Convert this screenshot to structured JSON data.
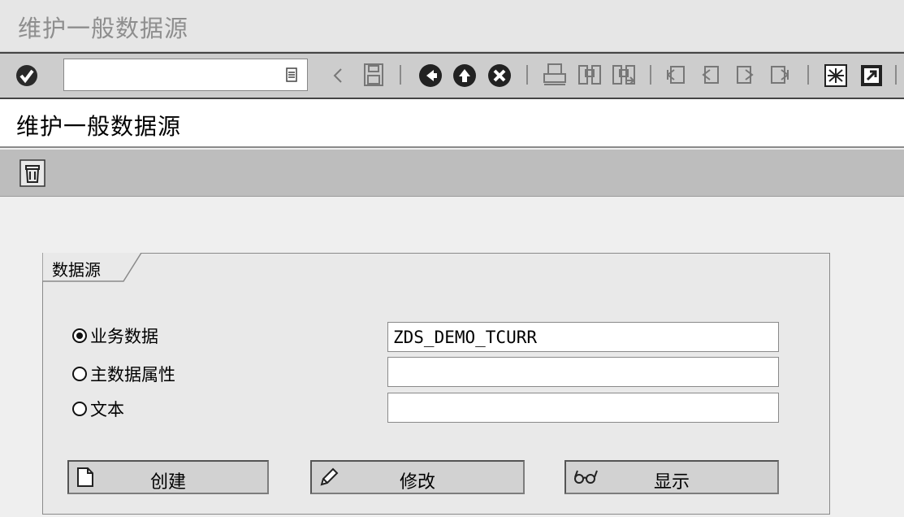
{
  "window": {
    "title": "维护一般数据源"
  },
  "toolbar": {
    "command_value": "",
    "icons": [
      "enter-icon",
      "dropdown-icon",
      "back-arrow-icon",
      "save-icon",
      "back-icon",
      "exit-icon",
      "cancel-icon",
      "print-icon",
      "find-icon",
      "find-next-icon",
      "first-page-icon",
      "previous-page-icon",
      "next-page-icon",
      "last-page-icon",
      "layout-icon",
      "help-icon"
    ]
  },
  "header": {
    "title": "维护一般数据源"
  },
  "app_toolbar": {
    "icons": [
      "delete-icon"
    ]
  },
  "group": {
    "title": "数据源",
    "options": [
      {
        "label": "业务数据",
        "checked": true,
        "value": "ZDS_DEMO_TCURR"
      },
      {
        "label": "主数据属性",
        "checked": false,
        "value": ""
      },
      {
        "label": "文本",
        "checked": false,
        "value": ""
      }
    ],
    "buttons": {
      "create": "创建",
      "change": "修改",
      "display": "显示"
    }
  },
  "colors": {
    "title_gray": "#8e8e8e",
    "toolbar_bg": "#cdcdcd",
    "app_toolbar_bg": "#bdbdbd",
    "group_bg": "#e9e9e9"
  }
}
